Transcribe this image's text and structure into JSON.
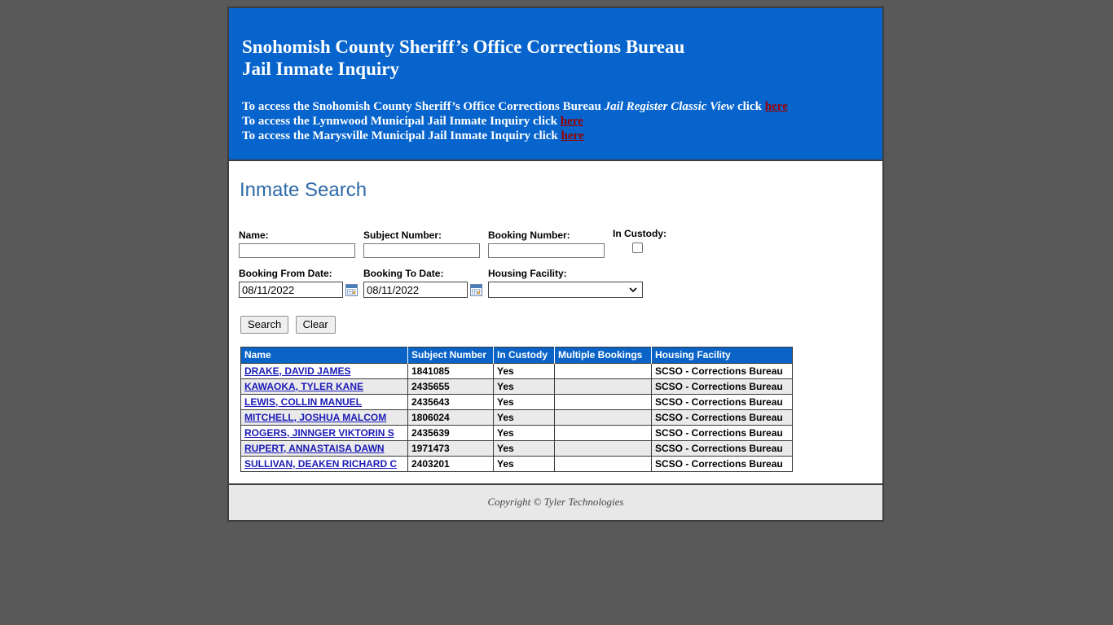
{
  "banner": {
    "title_line1": "Snohomish County Sheriff’s Office Corrections Bureau",
    "title_line2": "Jail Inmate Inquiry",
    "links": [
      {
        "prefix": "To access the Snohomish County Sheriff’s Office Corrections Bureau ",
        "italic": "Jail Register Classic View",
        "suffix": " click ",
        "link_label": "here"
      },
      {
        "prefix": "To access the Lynnwood Municipal Jail Inmate Inquiry click ",
        "italic": "",
        "suffix": "",
        "link_label": "here"
      },
      {
        "prefix": "To access the Marysville Municipal Jail Inmate Inquiry click ",
        "italic": "",
        "suffix": "",
        "link_label": "here"
      }
    ],
    "background_color": "#0664cc",
    "link_color": "#990000"
  },
  "search": {
    "heading": "Inmate Search",
    "heading_color": "#2f6aa8",
    "fields": {
      "name_label": "Name:",
      "name_value": "",
      "subject_number_label": "Subject Number:",
      "subject_number_value": "",
      "booking_number_label": "Booking Number:",
      "booking_number_value": "",
      "in_custody_label": "In Custody:",
      "in_custody_checked": false,
      "booking_from_label": "Booking From Date:",
      "booking_from_value": "08/11/2022",
      "booking_to_label": "Booking To Date:",
      "booking_to_value": "08/11/2022",
      "housing_facility_label": "Housing Facility:",
      "housing_facility_value": ""
    },
    "buttons": {
      "search_label": "Search",
      "clear_label": "Clear"
    }
  },
  "results": {
    "columns": [
      "Name",
      "Subject Number",
      "In Custody",
      "Multiple Bookings",
      "Housing Facility"
    ],
    "rows": [
      {
        "name": "DRAKE, DAVID JAMES",
        "subject_number": "1841085",
        "in_custody": "Yes",
        "multiple_bookings": "",
        "housing_facility": "SCSO - Corrections Bureau"
      },
      {
        "name": "KAWAOKA, TYLER KANE",
        "subject_number": "2435655",
        "in_custody": "Yes",
        "multiple_bookings": "",
        "housing_facility": "SCSO - Corrections Bureau"
      },
      {
        "name": "LEWIS, COLLIN MANUEL",
        "subject_number": "2435643",
        "in_custody": "Yes",
        "multiple_bookings": "",
        "housing_facility": "SCSO - Corrections Bureau"
      },
      {
        "name": "MITCHELL, JOSHUA MALCOM",
        "subject_number": "1806024",
        "in_custody": "Yes",
        "multiple_bookings": "",
        "housing_facility": "SCSO - Corrections Bureau"
      },
      {
        "name": "ROGERS, JINNGER VIKTORIN S",
        "subject_number": "2435639",
        "in_custody": "Yes",
        "multiple_bookings": "",
        "housing_facility": "SCSO - Corrections Bureau"
      },
      {
        "name": "RUPERT, ANNASTAISA DAWN",
        "subject_number": "1971473",
        "in_custody": "Yes",
        "multiple_bookings": "",
        "housing_facility": "SCSO - Corrections Bureau"
      },
      {
        "name": " SULLIVAN, DEAKEN RICHARD C",
        "subject_number": "2403201",
        "in_custody": "Yes",
        "multiple_bookings": "",
        "housing_facility": "SCSO - Corrections Bureau"
      }
    ]
  },
  "footer": {
    "copyright": "Copyright © Tyler Technologies"
  }
}
